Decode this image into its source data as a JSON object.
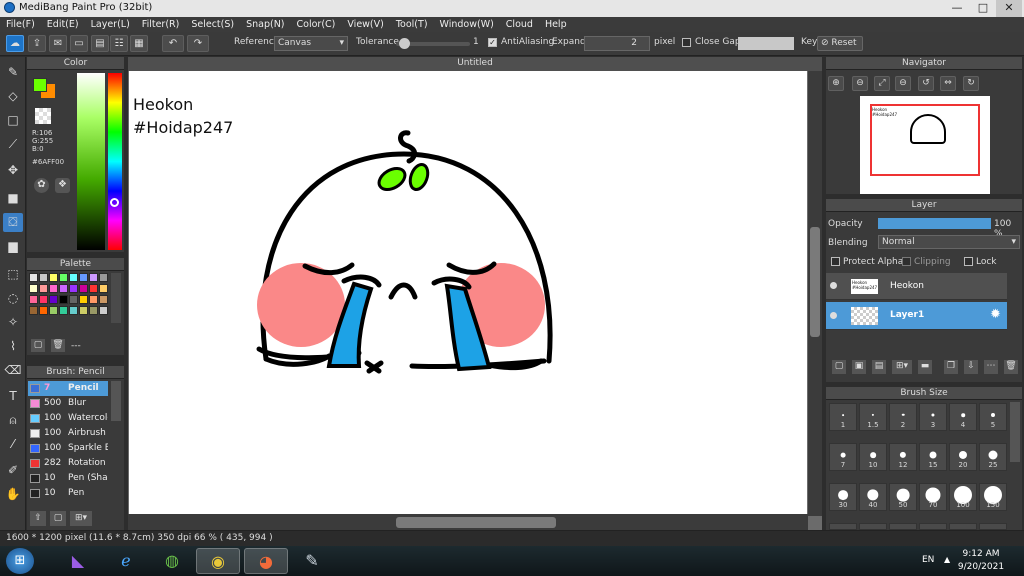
{
  "window": {
    "title": "MediBang Paint Pro (32bit)",
    "min": "—",
    "max": "□",
    "close": "✕"
  },
  "menu": [
    "File(F)",
    "Edit(E)",
    "Layer(L)",
    "Filter(R)",
    "Select(S)",
    "Snap(N)",
    "Color(C)",
    "View(V)",
    "Tool(T)",
    "Window(W)",
    "Cloud",
    "Help"
  ],
  "toolbar": {
    "reference_label": "Reference",
    "reference_value": "Canvas",
    "tolerance_label": "Tolerance",
    "tolerance_value": "1",
    "tolerance_level": 0.05,
    "antialiasing_label": "AntiAliasing",
    "antialiasing_checked": true,
    "expand_label": "Expand",
    "expand_value": "2",
    "expand_unit": "pixel",
    "close_gaps_label": "Close Gaps",
    "close_gaps_checked": false,
    "key_label": "Key",
    "reset_label": "Reset"
  },
  "color_panel": {
    "title": "Color",
    "r": "R:106",
    "g": "G:255",
    "b": "B:0",
    "hex": "#6AFF00",
    "primary": "#6aff00",
    "secondary": "#ff8c00"
  },
  "palette_panel": {
    "title": "Palette",
    "swatches": [
      "#e6e6e6",
      "#c8c8c8",
      "#ffff66",
      "#66ff66",
      "#66ffff",
      "#6699ff",
      "#cc99ff",
      "#999999",
      "#ffffcc",
      "#ff9999",
      "#ff66cc",
      "#cc66ff",
      "#9933ff",
      "#cc0099",
      "#ff3333",
      "#ffcc66",
      "#ff6699",
      "#ff3366",
      "#6600cc",
      "#000000",
      "#666666",
      "#ffcc00",
      "#ff9966",
      "#cc9966",
      "#996633",
      "#ff6600",
      "#99cc66",
      "#33cc99",
      "#66cccc",
      "#cccc66",
      "#999966",
      "#cccccc"
    ],
    "none_label": "---"
  },
  "brush_panel": {
    "title": "Brush: Pencil",
    "brushes": [
      {
        "size": "7",
        "name": "Pencil",
        "color": "#3b6ed6",
        "selected": true
      },
      {
        "size": "500",
        "name": "Blur",
        "color": "#f48ad4",
        "selected": false
      },
      {
        "size": "100",
        "name": "Watercolor",
        "color": "#66ccff",
        "selected": false
      },
      {
        "size": "100",
        "name": "Airbrush",
        "color": "#eeeeee",
        "selected": false
      },
      {
        "size": "100",
        "name": "Sparkle Br",
        "color": "#3366ff",
        "selected": false
      },
      {
        "size": "282",
        "name": "Rotation S",
        "color": "#ee3333",
        "selected": false
      },
      {
        "size": "10",
        "name": "Pen (Shar",
        "color": "#222222",
        "selected": false
      },
      {
        "size": "10",
        "name": "Pen",
        "color": "#222222",
        "selected": false
      }
    ]
  },
  "canvas": {
    "title": "Untitled",
    "text_line1": "Heokon",
    "text_line2": "#Hoidap247"
  },
  "navigator": {
    "title": "Navigator",
    "thumb_text1": "Heokon",
    "thumb_text2": "#Hoidap247"
  },
  "layer_panel": {
    "title": "Layer",
    "opacity_label": "Opacity",
    "opacity_value": "100 %",
    "opacity_level": 1.0,
    "blending_label": "Blending",
    "blending_value": "Normal",
    "protect_alpha": "Protect Alpha",
    "clipping": "Clipping",
    "lock": "Lock",
    "layers": [
      {
        "name": "Heokon",
        "selected": false
      },
      {
        "name": "Layer1",
        "selected": true
      }
    ]
  },
  "brush_size_panel": {
    "title": "Brush Size",
    "sizes": [
      "1",
      "1.5",
      "2",
      "3",
      "4",
      "5",
      "7",
      "10",
      "12",
      "15",
      "20",
      "25",
      "30",
      "40",
      "50",
      "70",
      "100",
      "150"
    ]
  },
  "statusbar": {
    "text": "1600 * 1200 pixel   (11.6 * 8.7cm)   350 dpi   66 %   ( 435, 994 )"
  },
  "taskbar": {
    "lang": "EN",
    "time": "9:12 AM",
    "date": "9/20/2021"
  }
}
